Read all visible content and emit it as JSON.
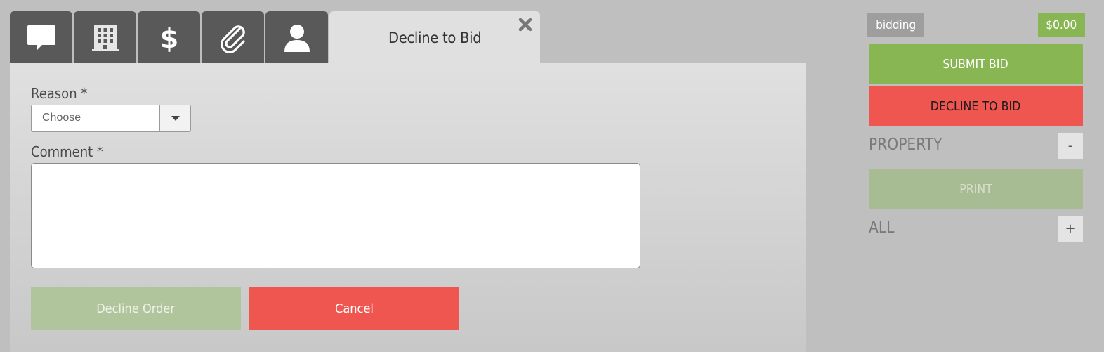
{
  "tabs": {
    "items": [
      {
        "name": "tab-messages",
        "icon": "speech-bubble-icon"
      },
      {
        "name": "tab-property",
        "icon": "building-icon"
      },
      {
        "name": "tab-pricing",
        "icon": "dollar-icon"
      },
      {
        "name": "tab-attachments",
        "icon": "paperclip-icon"
      },
      {
        "name": "tab-contact",
        "icon": "user-icon"
      }
    ],
    "active_title": "Decline to Bid",
    "close_icon": "close-icon"
  },
  "form": {
    "reason_label": "Reason *",
    "reason_value": "Choose",
    "comment_label": "Comment *",
    "comment_value": "",
    "decline_order_label": "Decline Order",
    "cancel_label": "Cancel"
  },
  "sidebar": {
    "status": "bidding",
    "amount": "$0.00",
    "submit_bid_label": "SUBMIT BID",
    "decline_to_bid_label": "DECLINE TO BID",
    "property_label": "PROPERTY",
    "property_toggle": "-",
    "print_label": "PRINT",
    "all_label": "ALL",
    "all_toggle": "+"
  },
  "colors": {
    "green": "#88b653",
    "red": "#ef5650",
    "tab_dark": "#595959",
    "disabled_green": "#b1c59c"
  }
}
